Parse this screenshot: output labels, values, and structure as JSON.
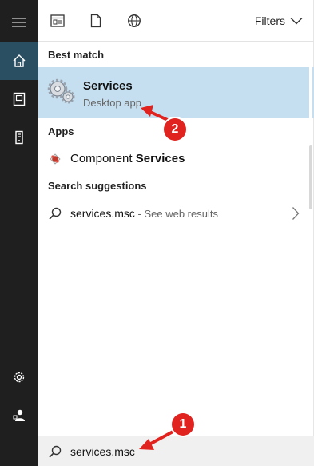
{
  "rail": {
    "items": [
      {
        "name": "menu-icon"
      },
      {
        "name": "home-icon",
        "active": true
      },
      {
        "name": "documents-icon"
      },
      {
        "name": "tower-icon"
      },
      {
        "name": "settings-icon"
      },
      {
        "name": "user-icon"
      }
    ]
  },
  "topbar": {
    "icons": [
      "apps-icon",
      "document-icon",
      "web-icon"
    ],
    "filters_label": "Filters"
  },
  "best_match": {
    "heading": "Best match",
    "title": "Services",
    "subtitle": "Desktop app",
    "icon": "gears-icon"
  },
  "apps": {
    "heading": "Apps",
    "items": [
      {
        "prefix": "Component ",
        "bold": "Services",
        "icon": "component-services-icon"
      }
    ]
  },
  "suggestions": {
    "heading": "Search suggestions",
    "items": [
      {
        "query": "services.msc",
        "hint": " - See web results",
        "icon": "search-icon"
      }
    ]
  },
  "searchbox": {
    "value": "services.msc",
    "icon": "search-icon"
  },
  "annotations": [
    {
      "number": "1"
    },
    {
      "number": "2"
    }
  ],
  "colors": {
    "rail_bg": "#1f1f1f",
    "rail_active": "#2a4f63",
    "highlight": "#c5dff0",
    "callout": "#e0231f"
  }
}
